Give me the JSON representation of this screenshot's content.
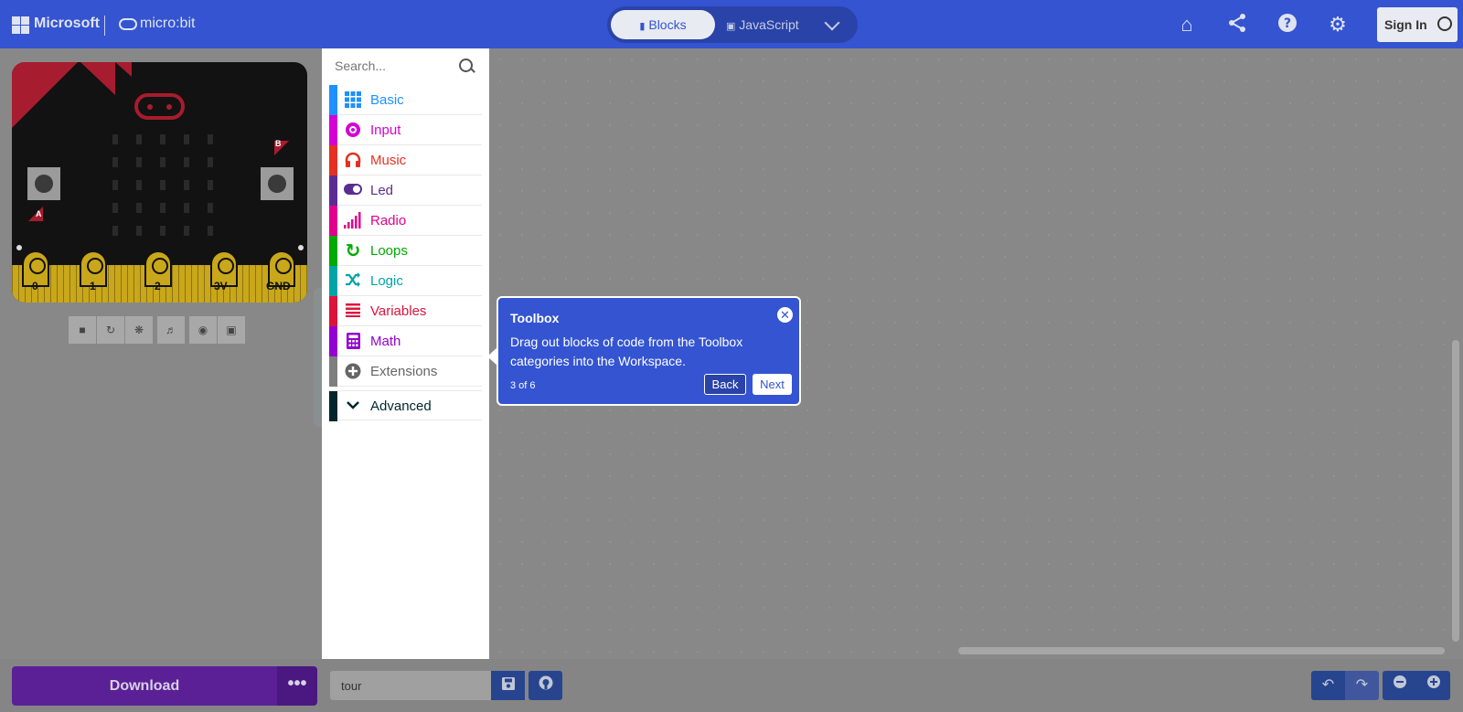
{
  "header": {
    "brand": "Microsoft",
    "product": "micro:bit",
    "editor_tabs": [
      {
        "label": "Blocks",
        "icon": "puzzle-icon",
        "active": true
      },
      {
        "label": "JavaScript",
        "icon": "js-icon",
        "active": false
      }
    ],
    "icons": [
      "home-icon",
      "share-icon",
      "help-icon",
      "gear-icon"
    ],
    "sign_in_label": "Sign In",
    "accent_color": "#3454d1"
  },
  "simulator": {
    "button_a": "A",
    "button_b": "B",
    "pins": [
      "0",
      "1",
      "2",
      "3V",
      "GND"
    ],
    "tools": [
      "stop-icon",
      "restart-icon",
      "debug-icon",
      "sound-icon",
      "screenshot-icon",
      "fullscreen-icon"
    ]
  },
  "toolbox": {
    "search_placeholder": "Search...",
    "categories": [
      {
        "label": "Basic",
        "color": "#1e90ff",
        "icon": "grid-icon"
      },
      {
        "label": "Input",
        "color": "#d400d4",
        "icon": "target-icon"
      },
      {
        "label": "Music",
        "color": "#e63022",
        "icon": "headphones-icon"
      },
      {
        "label": "Led",
        "color": "#5c2d91",
        "icon": "toggle-icon"
      },
      {
        "label": "Radio",
        "color": "#e3008c",
        "icon": "signal-icon"
      },
      {
        "label": "Loops",
        "color": "#00aa00",
        "icon": "loop-icon"
      },
      {
        "label": "Logic",
        "color": "#00a4a6",
        "icon": "shuffle-icon"
      },
      {
        "label": "Variables",
        "color": "#dc143c",
        "icon": "list-icon"
      },
      {
        "label": "Math",
        "color": "#9400d3",
        "icon": "calculator-icon"
      },
      {
        "label": "Extensions",
        "color": "#7f7f7f",
        "icon": "plus-circle-icon"
      },
      {
        "label": "Advanced",
        "color": "#00272b",
        "icon": "chevron-down-icon"
      }
    ]
  },
  "tour": {
    "title": "Toolbox",
    "body": "Drag out blocks of code from the Toolbox categories into the Workspace.",
    "step": "3 of 6",
    "back_label": "Back",
    "next_label": "Next"
  },
  "footer": {
    "download_label": "Download",
    "more_label": "•••",
    "project_name": "tour"
  }
}
